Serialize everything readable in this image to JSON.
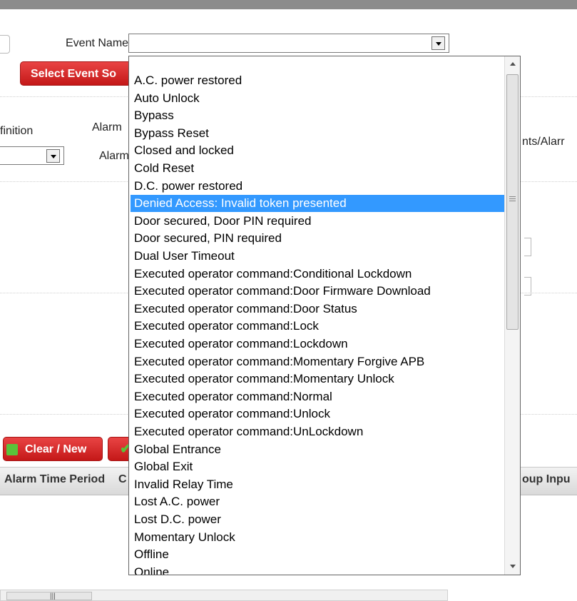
{
  "form": {
    "event_name_label": "Event Name:",
    "select_event_source_button": "Select Event So",
    "definition_label": "finition",
    "alarm_label_1": "Alarm",
    "alarm_label_2": "Alarm",
    "events_alarms_label": "nts/Alarr",
    "event_name_value": ""
  },
  "toolbar": {
    "clear_new_label": "Clear / New",
    "save_icon_name": "check-icon",
    "clear_icon_name": "plus-icon"
  },
  "table": {
    "columns": [
      "Alarm Time Period",
      "C",
      "oup Inpu"
    ]
  },
  "dropdown": {
    "selected_index": 7,
    "selected_color": "#3399ff",
    "options": [
      "A.C. power restored",
      "Auto Unlock",
      "Bypass",
      "Bypass Reset",
      "Closed and locked",
      "Cold Reset",
      "D.C. power restored",
      "Denied Access: Invalid token presented",
      "Door secured, Door PIN required",
      "Door secured, PIN required",
      "Dual User Timeout",
      "Executed operator command:Conditional Lockdown",
      "Executed operator command:Door Firmware Download",
      "Executed operator command:Door Status",
      "Executed operator command:Lock",
      "Executed operator command:Lockdown",
      "Executed operator command:Momentary Forgive APB",
      "Executed operator command:Momentary Unlock",
      "Executed operator command:Normal",
      "Executed operator command:Unlock",
      "Executed operator command:UnLockdown",
      "Global Entrance",
      "Global Exit",
      "Invalid Relay Time",
      "Lost A.C. power",
      "Lost D.C. power",
      "Momentary Unlock",
      "Offline",
      "Online"
    ]
  }
}
